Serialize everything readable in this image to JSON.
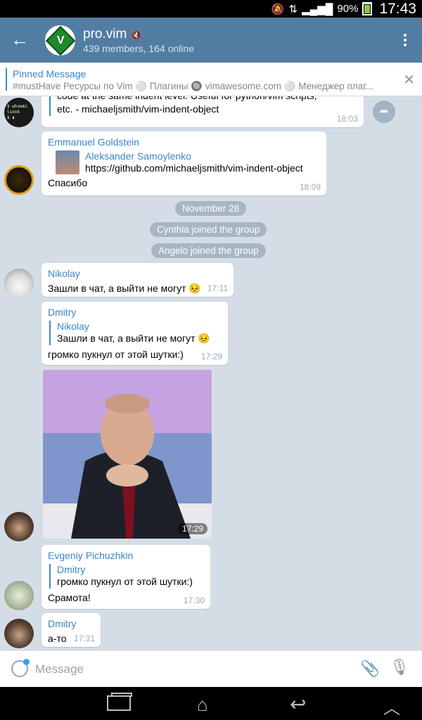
{
  "status_bar": {
    "battery": "90%",
    "time": "17:43"
  },
  "header": {
    "title": "pro.vim",
    "subtitle": "439 members, 164 online"
  },
  "pinned": {
    "title": "Pinned Message",
    "text": "#mustHave  Ресурсы по Vim ⚪ Плагины   🔘 vimawesome.com ⚪ Менеджер плаг..."
  },
  "messages": {
    "m1": {
      "text_line1": "code at the same indent level. Useful for python/vim scripts,",
      "text_line2": "etc. - michaeljsmith/vim-indent-object",
      "time": "18:03"
    },
    "m2": {
      "sender": "Emmanuel Goldstein",
      "quote_name": "Aleksander Samoylenko",
      "quote_text": "https://github.com/michaeljsmith/vim-indent-object",
      "text": "Спасибо",
      "time": "18:09"
    },
    "date_divider": "November 28",
    "join1": "Cynthia joined the group",
    "join2": "Angelo joined the group",
    "m3": {
      "sender": "Nikolay",
      "text": "Зашли в чат, а выйти не могут 😣",
      "time": "17:11"
    },
    "m4": {
      "sender": "Dmitry",
      "quote_name": "Nikolay",
      "quote_text": "Зашли в чат, а выйти не могут 😣",
      "text": "громко пукнул от этой шутки:)",
      "time": "17:29"
    },
    "m5": {
      "time": "17:29"
    },
    "m6": {
      "sender": "Evgeniy Pichuzhkin",
      "quote_name": "Dmitry",
      "quote_text": "громко пукнул от этой шутки:)",
      "text": "Срамота!",
      "time": "17:30"
    },
    "m7": {
      "sender": "Dmitry",
      "text": "а-то",
      "time": "17:31"
    }
  },
  "input": {
    "placeholder": "Message"
  },
  "colors": {
    "header": "#527da3",
    "accent": "#3a86c8",
    "chat_bg": "#d4dde6"
  }
}
